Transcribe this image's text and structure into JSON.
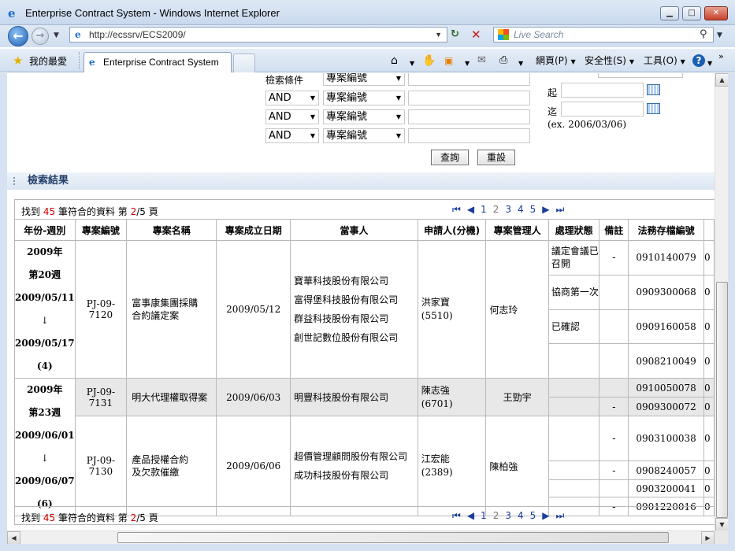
{
  "window": {
    "title": "Enterprise Contract System - Windows Internet Explorer"
  },
  "address": {
    "url": "http://ecssrv/ECS2009/",
    "search_placeholder": "Live Search"
  },
  "tabs": {
    "favorites": "我的最愛",
    "active": "Enterprise Contract System"
  },
  "toolbar": {
    "page": "網頁(P)",
    "safety": "安全性(S)",
    "tools": "工具(O)"
  },
  "search": {
    "condition_label": "檢索條件",
    "field": "專案編號",
    "op": "AND",
    "start_label": "起",
    "end_label": "迄",
    "date_hint": "(ex. 2006/03/06)",
    "query_button": "查詢",
    "reset_button": "重設"
  },
  "results": {
    "section_title": "檢索結果",
    "found_prefix": "找到",
    "count": "45",
    "found_mid": "筆符合的資料 第",
    "page_current": "2",
    "page_sep": "/",
    "page_total": "5",
    "page_suffix": "頁",
    "pages": [
      "1",
      "2",
      "3",
      "4",
      "5"
    ],
    "columns": [
      "年份-週別",
      "專案編號",
      "專案名稱",
      "專案成立日期",
      "當事人",
      "申請人(分機)",
      "專案管理人",
      "處理狀態",
      "備註",
      "法務存檔編號"
    ],
    "rows": [
      {
        "year": "2009年",
        "week": "第20週",
        "from": "2009/05/11",
        "arrow": "↓",
        "to": "2009/05/17",
        "count": "(4)",
        "id": "PJ-09-7120",
        "name1": "富事康集團採購",
        "name2": "合約議定案",
        "date": "2009/05/12",
        "parties": [
          "寶華科技股份有限公司",
          "富得堡科技股份有限公司",
          "群益科技股份有限公司",
          "創世記數位股份有限公司"
        ],
        "applicant": "洪家寶",
        "ext": "(5510)",
        "manager": "何志玲",
        "subs": [
          {
            "status": "議定會議已召開",
            "note": "-",
            "file": "0910140079",
            "more": "0"
          },
          {
            "status": "協商第一次",
            "note": "",
            "file": "0909300068",
            "more": "0"
          },
          {
            "status": "已確認",
            "note": "",
            "file": "0909160058",
            "more": "0"
          },
          {
            "status": "",
            "note": "",
            "file": "0908210049",
            "more": "0"
          }
        ]
      },
      {
        "year": "2009年",
        "week": "第23週",
        "from": "2009/06/01",
        "arrow": "↓",
        "to": "2009/06/07",
        "count": "(6)",
        "id": "PJ-09-7131",
        "name1": "明大代理權取得案",
        "date": "2009/06/03",
        "party": "明豐科技股份有限公司",
        "applicant": "陳志強",
        "ext": "(6701)",
        "manager": "王勁宇",
        "subs": [
          {
            "status": "",
            "note": "",
            "file": "0910050078",
            "more": "0"
          },
          {
            "status": "",
            "note": "-",
            "file": "0909300072",
            "more": "0"
          }
        ]
      },
      {
        "id": "PJ-09-7130",
        "name1": "產品授權合約",
        "name2": "及欠款催繳",
        "date": "2009/06/06",
        "parties": [
          "超價管理顧問股份有限公司",
          "成功科技股份有限公司"
        ],
        "applicant": "江宏能",
        "ext": "(2389)",
        "manager": "陳柏強",
        "subs": [
          {
            "status": "",
            "note": "-",
            "file": "0903100038",
            "more": "0"
          },
          {
            "status": "",
            "note": "-",
            "file": "0908240057",
            "more": "0"
          },
          {
            "status": "",
            "note": "",
            "file": "0903200041",
            "more": "0"
          },
          {
            "status": "",
            "note": "-",
            "file": "0901220016",
            "more": "0"
          }
        ]
      }
    ]
  }
}
